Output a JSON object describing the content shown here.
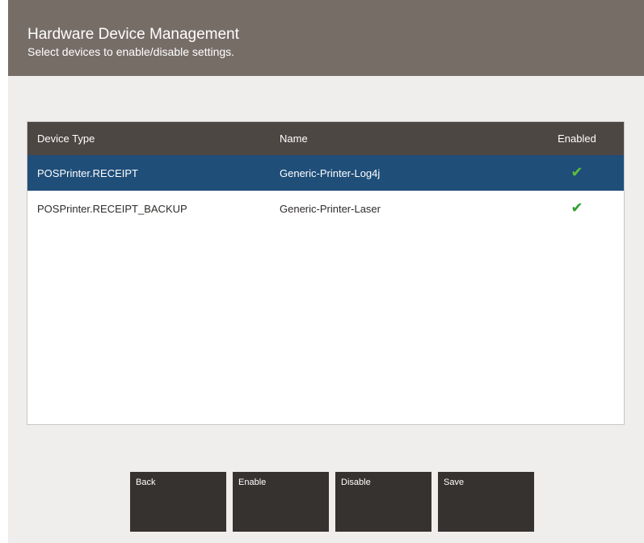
{
  "header": {
    "title": "Hardware Device Management",
    "subtitle": "Select devices to enable/disable settings."
  },
  "table": {
    "columns": [
      "Device Type",
      "Name",
      "Enabled"
    ],
    "rows": [
      {
        "device_type": "POSPrinter.RECEIPT",
        "name": "Generic-Printer-Log4j",
        "enabled": true,
        "selected": true,
        "enabled_icon": "check-icon"
      },
      {
        "device_type": "POSPrinter.RECEIPT_BACKUP",
        "name": "Generic-Printer-Laser",
        "enabled": true,
        "selected": false,
        "enabled_icon": "check-icon"
      }
    ]
  },
  "buttons": {
    "back": "Back",
    "enable": "Enable",
    "disable": "Disable",
    "save": "Save"
  },
  "colors": {
    "header_bg": "#776d67",
    "table_header_bg": "#4d4744",
    "selected_row_bg": "#1f4e79",
    "button_bg": "#363230",
    "check_green": "#2ea02e"
  }
}
